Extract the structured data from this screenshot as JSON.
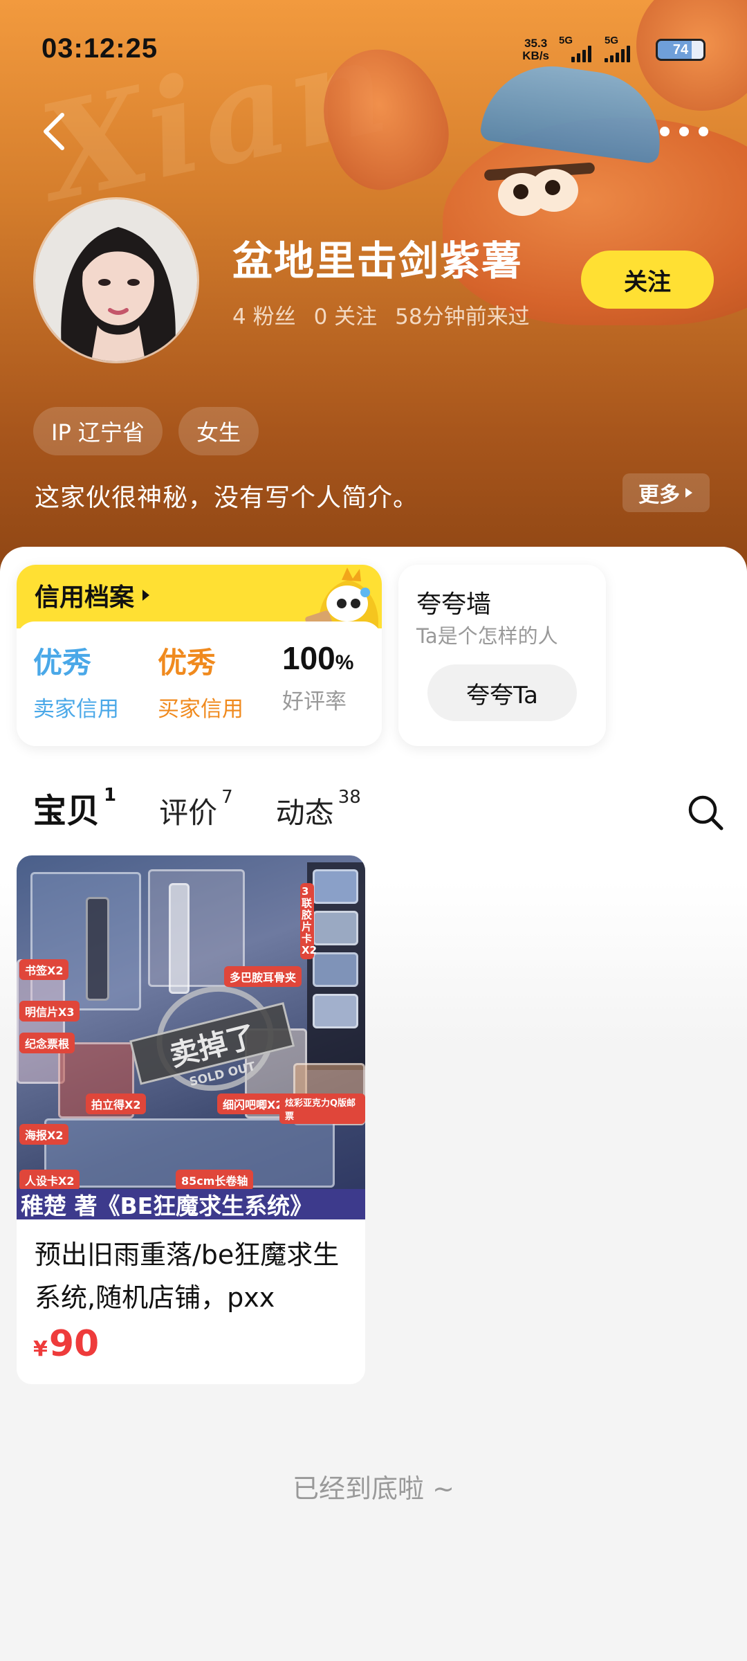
{
  "status_bar": {
    "time": "03:12:25",
    "net_speed_value": "35.3",
    "net_speed_unit": "KB/s",
    "signal1_label": "5G",
    "signal2_label": "5G",
    "battery": "74"
  },
  "profile": {
    "name": "盆地里击剑紫薯",
    "fans": "4 粉丝",
    "following": "0 关注",
    "last_seen": "58分钟前来过",
    "follow_label": "关注",
    "tags": [
      "IP 辽宁省",
      "女生"
    ],
    "bio": "这家伙很神秘，没有写个人简介。",
    "more_label": "更多"
  },
  "credit": {
    "title": "信用档案",
    "seller_value": "优秀",
    "seller_label": "卖家信用",
    "buyer_value": "优秀",
    "buyer_label": "买家信用",
    "rate_value": "100",
    "rate_unit": "%",
    "rate_label": "好评率"
  },
  "praise": {
    "title": "夸夸墙",
    "subtitle": "Ta是个怎样的人",
    "button": "夸夸Ta"
  },
  "tabs": [
    {
      "label": "宝贝",
      "count": "1"
    },
    {
      "label": "评价",
      "count": "7"
    },
    {
      "label": "动态",
      "count": "38"
    }
  ],
  "product": {
    "title": "预出旧雨重落/be狂魔求生系统,随机店铺，pxx",
    "currency": "¥",
    "price": "90",
    "image_banner": "稚楚 著《BE狂魔求生系统》",
    "sold_out_cn": "卖掉了",
    "sold_out_en": "SOLD OUT",
    "image_tags": [
      "3联胶片卡X2",
      "多巴胺耳骨夹",
      "书签X2",
      "明信片X3",
      "纪念票根",
      "拍立得X2",
      "细闪吧唧X2",
      "炫彩亚克力Q版邮票",
      "海报X2",
      "人设卡X2",
      "85cm长卷轴"
    ]
  },
  "footer": {
    "end_text": "已经到底啦 ~"
  },
  "colors": {
    "accent_yellow": "#ffe033",
    "seller_blue": "#4aa8e8",
    "buyer_orange": "#f08a1e",
    "price_red": "#ee3b3b"
  }
}
